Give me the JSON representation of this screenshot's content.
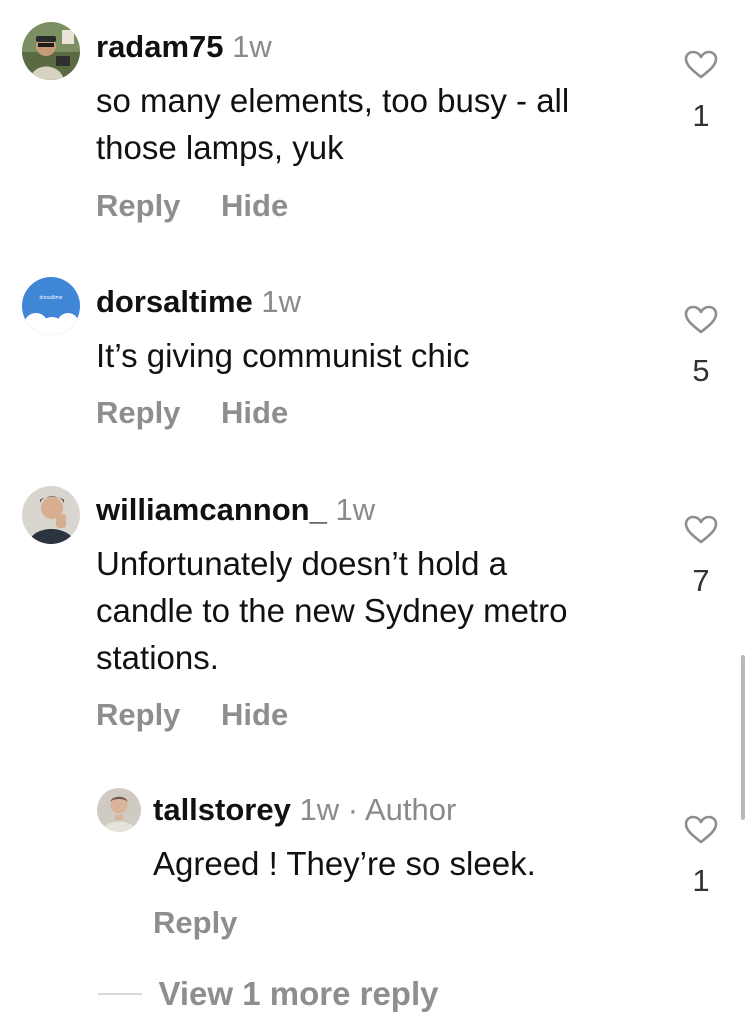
{
  "comments": [
    {
      "username": "radam75",
      "time": "1w",
      "text_lines": [
        "so many elements, too busy - all",
        "those lamps, yuk"
      ],
      "likes": "1",
      "reply_label": "Reply",
      "hide_label": "Hide"
    },
    {
      "username": "dorsaltime",
      "time": "1w",
      "text_lines": [
        "It’s giving communist chic"
      ],
      "likes": "5",
      "reply_label": "Reply",
      "hide_label": "Hide",
      "avatar_text": "dorsaltime"
    },
    {
      "username": "williamcannon_",
      "time": "1w",
      "text_lines": [
        "Unfortunately doesn’t hold a",
        "candle to the new Sydney metro",
        "stations."
      ],
      "likes": "7",
      "reply_label": "Reply",
      "hide_label": "Hide"
    }
  ],
  "reply": {
    "username": "tallstorey",
    "time": "1w",
    "author_tag": "· Author",
    "text_lines": [
      "Agreed ! They’re so sleek."
    ],
    "likes": "1",
    "reply_label": "Reply"
  },
  "view_more": {
    "label": "View 1 more reply"
  },
  "colors": {
    "text": "#111111",
    "secondary": "#8e8e8e",
    "heart_stroke": "#8e8e8e"
  }
}
